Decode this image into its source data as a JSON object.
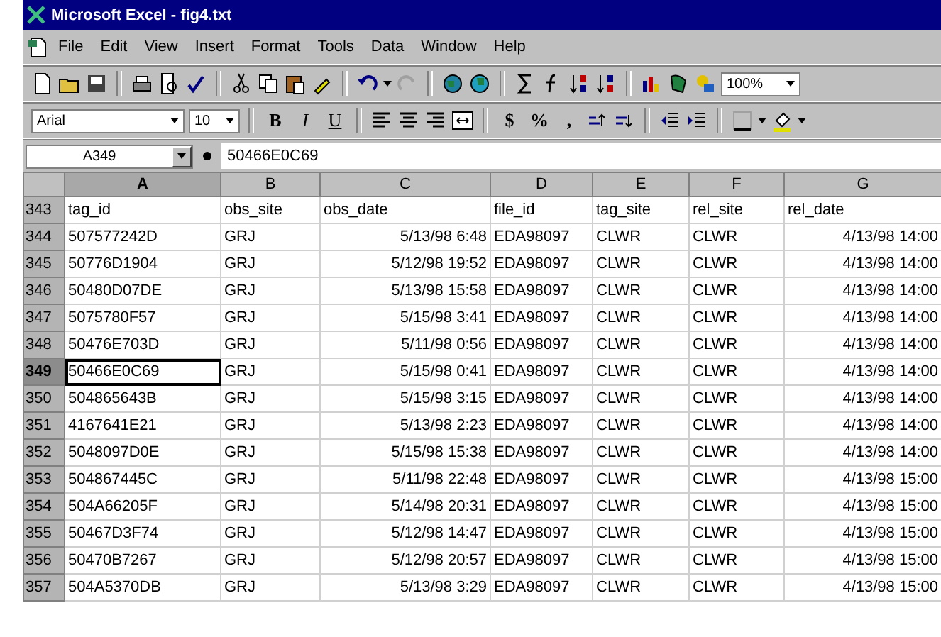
{
  "window": {
    "title": "Microsoft Excel - fig4.txt"
  },
  "menu": [
    "File",
    "Edit",
    "View",
    "Insert",
    "Format",
    "Tools",
    "Data",
    "Window",
    "Help"
  ],
  "standard_toolbar": {
    "zoom": "100%"
  },
  "formatting_toolbar": {
    "font": "Arial",
    "size": "10",
    "style_buttons": [
      {
        "label": "B",
        "kind": "bold"
      },
      {
        "label": "I",
        "kind": "italic"
      },
      {
        "label": "U",
        "kind": "underline"
      }
    ],
    "number_buttons": [
      "$",
      "%",
      ","
    ]
  },
  "formula_bar": {
    "name_box": "A349",
    "value": "50466E0C69"
  },
  "sheet": {
    "columns": [
      {
        "letter": "A",
        "selected": true,
        "numeric": false
      },
      {
        "letter": "B",
        "selected": false,
        "numeric": false
      },
      {
        "letter": "C",
        "selected": false,
        "numeric": true
      },
      {
        "letter": "D",
        "selected": false,
        "numeric": false
      },
      {
        "letter": "E",
        "selected": false,
        "numeric": false
      },
      {
        "letter": "F",
        "selected": false,
        "numeric": false
      },
      {
        "letter": "G",
        "selected": false,
        "numeric": true
      }
    ],
    "rows": [
      {
        "number": "343",
        "kind": "header",
        "selected": false,
        "cells": [
          "tag_id",
          "obs_site",
          "obs_date",
          "file_id",
          "tag_site",
          "rel_site",
          "rel_date"
        ]
      },
      {
        "number": "344",
        "kind": "data",
        "selected": false,
        "cells": [
          "507577242D",
          "GRJ",
          "5/13/98 6:48",
          "EDA98097",
          "CLWR",
          "CLWR",
          "4/13/98 14:00"
        ]
      },
      {
        "number": "345",
        "kind": "data",
        "selected": false,
        "cells": [
          "50776D1904",
          "GRJ",
          "5/12/98 19:52",
          "EDA98097",
          "CLWR",
          "CLWR",
          "4/13/98 14:00"
        ]
      },
      {
        "number": "346",
        "kind": "data",
        "selected": false,
        "cells": [
          "50480D07DE",
          "GRJ",
          "5/13/98 15:58",
          "EDA98097",
          "CLWR",
          "CLWR",
          "4/13/98 14:00"
        ]
      },
      {
        "number": "347",
        "kind": "data",
        "selected": false,
        "cells": [
          "5075780F57",
          "GRJ",
          "5/15/98 3:41",
          "EDA98097",
          "CLWR",
          "CLWR",
          "4/13/98 14:00"
        ]
      },
      {
        "number": "348",
        "kind": "data",
        "selected": false,
        "cells": [
          "50476E703D",
          "GRJ",
          "5/11/98 0:56",
          "EDA98097",
          "CLWR",
          "CLWR",
          "4/13/98 14:00"
        ]
      },
      {
        "number": "349",
        "kind": "data",
        "selected": true,
        "cells": [
          "50466E0C69",
          "GRJ",
          "5/15/98 0:41",
          "EDA98097",
          "CLWR",
          "CLWR",
          "4/13/98 14:00"
        ]
      },
      {
        "number": "350",
        "kind": "data",
        "selected": false,
        "cells": [
          "504865643B",
          "GRJ",
          "5/15/98 3:15",
          "EDA98097",
          "CLWR",
          "CLWR",
          "4/13/98 14:00"
        ]
      },
      {
        "number": "351",
        "kind": "data",
        "selected": false,
        "cells": [
          "4167641E21",
          "GRJ",
          "5/13/98 2:23",
          "EDA98097",
          "CLWR",
          "CLWR",
          "4/13/98 14:00"
        ]
      },
      {
        "number": "352",
        "kind": "data",
        "selected": false,
        "cells": [
          "5048097D0E",
          "GRJ",
          "5/15/98 15:38",
          "EDA98097",
          "CLWR",
          "CLWR",
          "4/13/98 14:00"
        ]
      },
      {
        "number": "353",
        "kind": "data",
        "selected": false,
        "cells": [
          "504867445C",
          "GRJ",
          "5/11/98 22:48",
          "EDA98097",
          "CLWR",
          "CLWR",
          "4/13/98 15:00"
        ]
      },
      {
        "number": "354",
        "kind": "data",
        "selected": false,
        "cells": [
          "504A66205F",
          "GRJ",
          "5/14/98 20:31",
          "EDA98097",
          "CLWR",
          "CLWR",
          "4/13/98 15:00"
        ]
      },
      {
        "number": "355",
        "kind": "data",
        "selected": false,
        "cells": [
          "50467D3F74",
          "GRJ",
          "5/12/98 14:47",
          "EDA98097",
          "CLWR",
          "CLWR",
          "4/13/98 15:00"
        ]
      },
      {
        "number": "356",
        "kind": "data",
        "selected": false,
        "cells": [
          "50470B7267",
          "GRJ",
          "5/12/98 20:57",
          "EDA98097",
          "CLWR",
          "CLWR",
          "4/13/98 15:00"
        ]
      },
      {
        "number": "357",
        "kind": "data",
        "selected": false,
        "cells": [
          "504A5370DB",
          "GRJ",
          "5/13/98 3:29",
          "EDA98097",
          "CLWR",
          "CLWR",
          "4/13/98 15:00"
        ]
      }
    ]
  }
}
